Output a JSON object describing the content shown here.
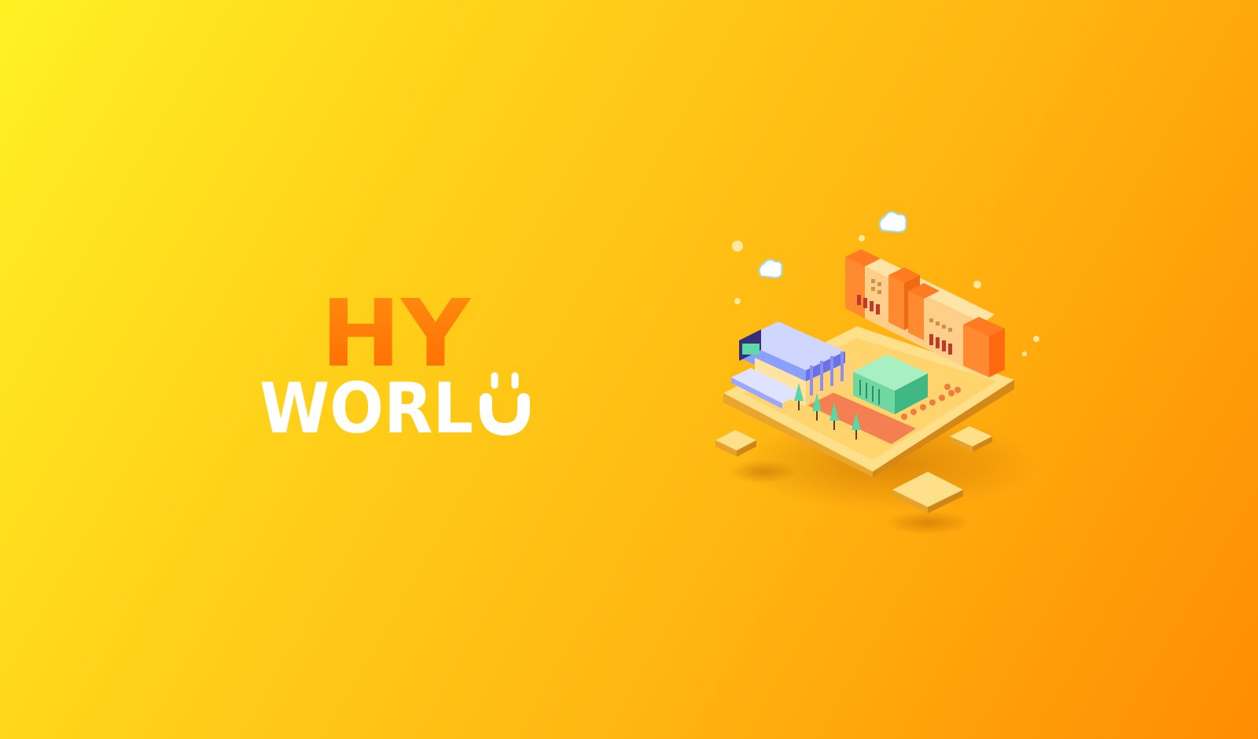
{
  "splash": {
    "logo_line1": "HY",
    "logo_line2": "WORL",
    "colors": {
      "bg_start": "#fff124",
      "bg_end": "#ff8c02",
      "logo_top": "#ff7a0e",
      "logo_bottom": "#ffffff"
    }
  }
}
